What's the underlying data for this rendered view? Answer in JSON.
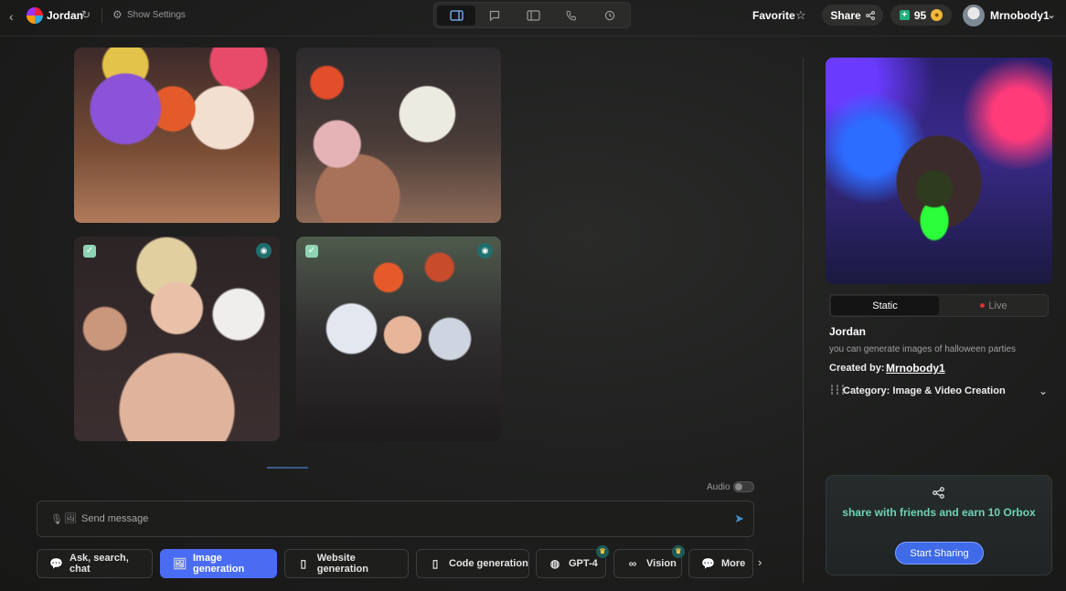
{
  "header": {
    "bot_name": "Jordan",
    "show_settings": "Show Settings",
    "favorite_label": "Favorite",
    "share_label": "Share",
    "orbox_count": "95",
    "username": "Mrnobody1"
  },
  "gallery": {
    "images": [
      {
        "alt": "Group of women in Day of the Dead face paint with flower crowns",
        "selected": false
      },
      {
        "alt": "Skull painted faces at a party",
        "selected": false
      },
      {
        "alt": "Women with halloween makeup and black lace",
        "selected": true
      },
      {
        "alt": "Women with sugar skull face paint and flower crowns",
        "selected": true
      }
    ]
  },
  "composer": {
    "audio_label": "Audio",
    "placeholder": "Send message"
  },
  "modes": [
    {
      "label": "Ask, search, chat",
      "icon": "chat-bubbles-icon"
    },
    {
      "label": "Image generation",
      "icon": "image-icon"
    },
    {
      "label": "Website generation",
      "icon": "document-icon"
    },
    {
      "label": "Code generation",
      "icon": "document-icon"
    },
    {
      "label": "GPT-4",
      "icon": "chat-bubble-icon"
    },
    {
      "label": "Vision",
      "icon": "glasses-icon"
    },
    {
      "label": "More",
      "icon": "chat-bubbles-icon"
    }
  ],
  "bot_panel": {
    "tabs": [
      "Static",
      "Live"
    ],
    "name": "Jordan",
    "description": "you can generate images of halloween parties",
    "created_by_label": "Created by:",
    "creator": "Mrnobody1",
    "category": "Category: Image & Video Creation"
  },
  "share_card": {
    "text": "share with friends and earn 10 Orbox",
    "button": "Start Sharing"
  },
  "colors": {
    "accent": "#4a6cf2",
    "share_text": "#6fd3b8",
    "live_dot": "#e03030"
  }
}
